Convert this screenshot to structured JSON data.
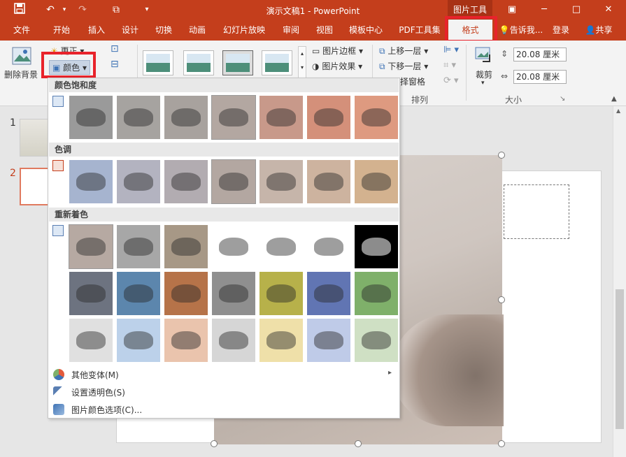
{
  "title_bar": {
    "doc_title": "演示文稿1 - PowerPoint",
    "tool_tab": "图片工具",
    "buttons": {
      "save_icon": "save-icon",
      "undo_icon": "undo-icon",
      "redo_icon": "redo-icon",
      "minimize": "─",
      "restore": "□",
      "close": "✕"
    }
  },
  "tabs": [
    {
      "label": "文件"
    },
    {
      "label": "开始"
    },
    {
      "label": "插入"
    },
    {
      "label": "设计"
    },
    {
      "label": "切换"
    },
    {
      "label": "动画"
    },
    {
      "label": "幻灯片放映"
    },
    {
      "label": "审阅"
    },
    {
      "label": "视图"
    },
    {
      "label": "模板中心"
    },
    {
      "label": "PDF工具集"
    },
    {
      "label": "格式"
    }
  ],
  "tabrow_right": {
    "tell_me": "告诉我...",
    "login": "登录",
    "share": "共享"
  },
  "ribbon": {
    "remove_bg": "删除背景",
    "corrections": "更正",
    "color": "颜色",
    "pic_border": "图片边框",
    "pic_effect": "图片效果",
    "bring_forward": "上移一层",
    "send_backward": "下移一层",
    "selection_pane": "择窗格",
    "arrange_group": "排列",
    "crop": "裁剪",
    "height_value": "20.08 厘米",
    "width_value": "20.08 厘米",
    "size_group": "大小"
  },
  "slides": [
    {
      "num": "1"
    },
    {
      "num": "2"
    }
  ],
  "color_menu": {
    "saturation_title": "颜色饱和度",
    "tone_title": "色调",
    "recolor_title": "重新着色",
    "saturation_colors": [
      "#9a9a9a",
      "#a6a3a0",
      "#a8a29e",
      "#b3a7a1",
      "#c8998a",
      "#d4907a",
      "#de9a80"
    ],
    "tone_colors": [
      "#a6b4cf",
      "#b3b3c0",
      "#b2acb1",
      "#b3a7a1",
      "#c6b5aa",
      "#cdb39f",
      "#d3b28f"
    ],
    "recolor_rows": [
      [
        "#b6a9a2",
        "#a7a7a7",
        "#a79886",
        "#ffffff",
        "#ffffff",
        "#ffffff",
        "#000000"
      ],
      [
        "#6d7380",
        "#5c86ad",
        "#b67349",
        "#8f8f8f",
        "#b7b14a",
        "#6175b3",
        "#7fb06a"
      ],
      [
        "#e0e0e0",
        "#bcd1ea",
        "#eac4ad",
        "#d6d6d6",
        "#efe0a9",
        "#bfcbe8",
        "#cfe0c4"
      ]
    ],
    "more_variations": "其他变体(M)",
    "set_transparent": "设置透明色(S)",
    "color_options": "图片颜色选项(C)..."
  }
}
